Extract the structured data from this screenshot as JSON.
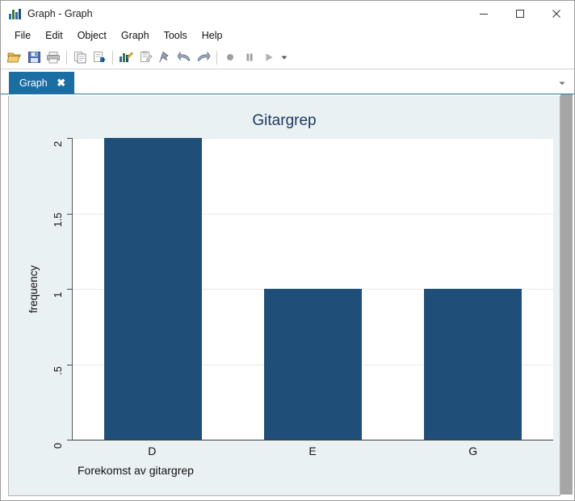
{
  "window": {
    "title": "Graph - Graph",
    "icon": "bar-chart-icon",
    "controls": {
      "minimize": "minimize-icon",
      "maximize": "maximize-icon",
      "close": "close-icon"
    }
  },
  "menubar": {
    "items": [
      {
        "label": "File"
      },
      {
        "label": "Edit"
      },
      {
        "label": "Object"
      },
      {
        "label": "Graph"
      },
      {
        "label": "Tools"
      },
      {
        "label": "Help"
      }
    ]
  },
  "toolbar": {
    "buttons": [
      {
        "name": "open-file-icon"
      },
      {
        "name": "save-icon"
      },
      {
        "name": "print-icon"
      },
      {
        "name": "copy-icon"
      },
      {
        "name": "paste-icon"
      },
      {
        "name": "graph-editor-icon"
      },
      {
        "name": "new-log-icon"
      },
      {
        "name": "pin-icon"
      },
      {
        "name": "undo-icon"
      },
      {
        "name": "redo-icon"
      },
      {
        "name": "record-icon"
      },
      {
        "name": "pause-icon"
      },
      {
        "name": "play-icon"
      },
      {
        "name": "chevron-down-icon"
      }
    ]
  },
  "tabs": {
    "items": [
      {
        "label": "Graph",
        "close": "✖",
        "active": true
      }
    ],
    "dropdown": "chevron-down-icon"
  },
  "chart_data": {
    "type": "bar",
    "title": "Gitargrep",
    "xlabel": "Forekomst av gitargrep",
    "ylabel": "frequency",
    "categories": [
      "D",
      "E",
      "G"
    ],
    "values": [
      2,
      1,
      1
    ],
    "ylim": [
      0,
      2
    ],
    "yticks": [
      "0",
      ".5",
      "1",
      "1.5",
      "2"
    ],
    "ytick_values": [
      0,
      0.5,
      1,
      1.5,
      2
    ],
    "grid": true,
    "legend": "none",
    "colors": {
      "bar": "#1f4e79",
      "title": "#1f3864",
      "plot_background": "#ffffff",
      "graph_background": "#e9f1f3",
      "gridline": "#e8e8e8"
    }
  }
}
